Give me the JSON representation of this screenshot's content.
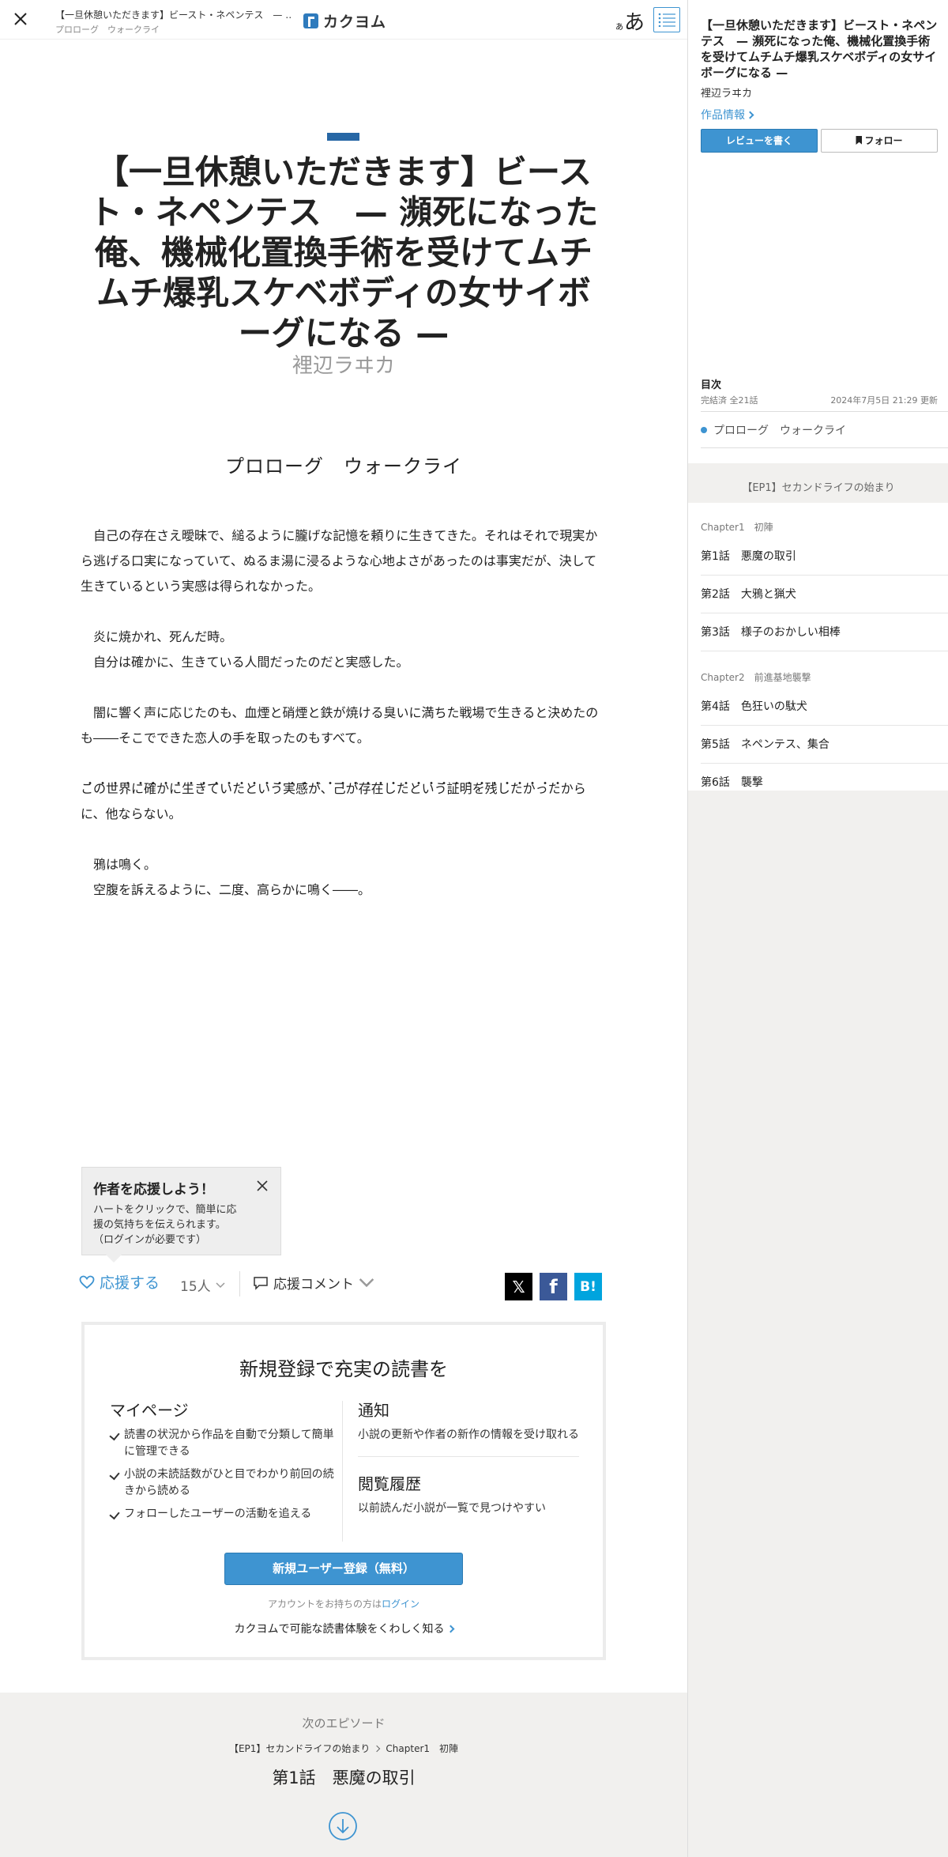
{
  "header": {
    "work_title": "【一旦休憩いただきます】ビースト・ネペンテス　— …",
    "episode_title": "プロローグ　ウォークライ",
    "logo_text": "カクヨム",
    "font_button_small": "ぁ",
    "font_button_large": "あ"
  },
  "main": {
    "work_title": "【一旦休憩いただきます】ビースト・ネペンテス　— 瀕死になった俺、機械化置換手術を受けてムチムチ爆乳スケベボディの女サイボーグになる —",
    "author": "裡辺ラヰカ",
    "episode_title": "プロローグ　ウォークライ",
    "paragraphs": [
      "自己の存在さえ曖昧で、縋るように朧げな記憶を頼りに生きてきた。それはそれで現実から逃げる口実になっていて、ぬるま湯に浸るような心地よさがあったのは事実だが、決して生きているという実感は得られなかった。",
      "",
      "炎に焼かれ、死んだ時。",
      "自分は確かに、生きている人間だったのだと実感した。",
      "",
      "闇に響く声に応じたのも、血煙と硝煙と鉄が焼ける臭いに満ちた戦場で生きると決めたのも――そこでできた恋人の手を取ったのもすべて。",
      "",
      "この世界に確かに生きていたという実感が、己が存在したという証明を残したかったからに、他ならない。",
      "",
      "鴉は鳴く。",
      "空腹を訴えるように、二度、高らかに鳴く――。"
    ],
    "emphasis_line_1": "この世界に確かに生きていたという実感が、己が存在したという証明を残したかった",
    "emphasis_line_2": "からに、他ならない。"
  },
  "cheer_popup": {
    "title": "作者を応援しよう！",
    "desc_1": "ハートをクリックで、簡単に応",
    "desc_2": "援の気持ちを伝えられます。",
    "desc_3": "（ログインが必要です）"
  },
  "actions": {
    "cheer_label": "応援する",
    "cheer_count": "15人",
    "comment_label": "応援コメント",
    "share_x": "𝕏",
    "share_fb": "f",
    "share_hb": "B!"
  },
  "register": {
    "heading": "新規登録で充実の読書を",
    "mypage_title": "マイページ",
    "mypage_items": [
      "読書の状況から作品を自動で分類して簡単に管理できる",
      "小説の未読話数がひと目でわかり前回の続きから読める",
      "フォローしたユーザーの活動を追える"
    ],
    "notice_title": "通知",
    "notice_desc": "小説の更新や作者の新作の情報を受け取れる",
    "history_title": "閲覧履歴",
    "history_desc": "以前読んだ小説が一覧で見つけやすい",
    "register_button": "新規ユーザー登録（無料）",
    "login_prefix": "アカウントをお持ちの方は",
    "login_link": "ログイン",
    "more_link": "カクヨムで可能な読書体験をくわしく知る"
  },
  "next_episode": {
    "label": "次のエピソード",
    "crumb_1": "【EP1】セカンドライフの始まり",
    "crumb_2": "Chapter1　初陣",
    "title": "第1話　悪魔の取引"
  },
  "sidebar": {
    "work_title": "【一旦休憩いただきます】ビースト・ネペンテス　— 瀕死になった俺、機械化置換手術を受けてムチムチ爆乳スケベボディの女サイボーグになる —",
    "author": "裡辺ラヰカ",
    "info_link": "作品情報",
    "review_button": "レビューを書く",
    "follow_button": "フォロー",
    "toc_heading": "目次",
    "toc_status": "完結済 全21話",
    "toc_updated": "2024年7月5日 21:29 更新",
    "prologue": "プロローグ　ウォークライ",
    "ep_heading": "【EP1】セカンドライフの始まり",
    "chapter1": "Chapter1　初陣",
    "chapter2": "Chapter2　前進基地襲撃",
    "episodes": [
      "第1話　悪魔の取引",
      "第2話　大鴉と猟犬",
      "第3話　様子のおかしい相棒",
      "第4話　色狂いの駄犬",
      "第5話　ネペンテス、集合",
      "第6話　襲撃"
    ]
  },
  "colors": {
    "accent": "#3e94d1",
    "title_mark": "#2767a5",
    "sidebar_bg": "#f1f0ee"
  }
}
